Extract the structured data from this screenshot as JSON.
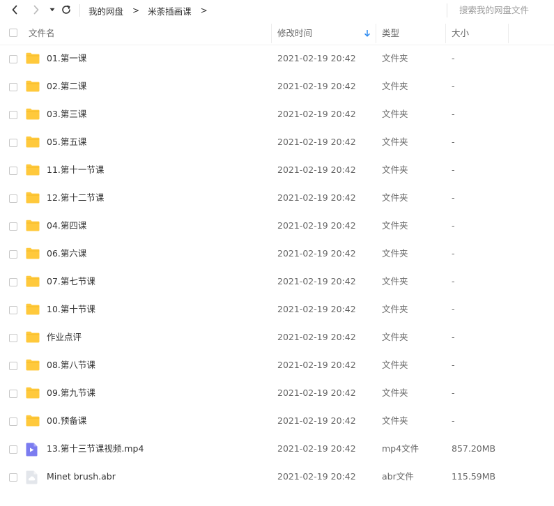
{
  "toolbar": {
    "breadcrumb": [
      {
        "label": "我的网盘"
      },
      {
        "label": "米荼插画课"
      }
    ],
    "breadcrumb_separator": ">",
    "search_placeholder": "搜索我的网盘文件"
  },
  "columns": {
    "name": "文件名",
    "modified": "修改时间",
    "type": "类型",
    "size": "大小"
  },
  "sort": {
    "column": "modified",
    "direction": "desc"
  },
  "colors": {
    "folder": "#ffc93c",
    "video": "#7b7cf0",
    "accent": "#2f8cf0"
  },
  "files": [
    {
      "icon": "folder-icon",
      "name": "01.第一课",
      "modified": "2021-02-19 20:42",
      "type": "文件夹",
      "size": "-"
    },
    {
      "icon": "folder-icon",
      "name": "02.第二课",
      "modified": "2021-02-19 20:42",
      "type": "文件夹",
      "size": "-"
    },
    {
      "icon": "folder-icon",
      "name": "03.第三课",
      "modified": "2021-02-19 20:42",
      "type": "文件夹",
      "size": "-"
    },
    {
      "icon": "folder-icon",
      "name": "05.第五课",
      "modified": "2021-02-19 20:42",
      "type": "文件夹",
      "size": "-"
    },
    {
      "icon": "folder-icon",
      "name": "11.第十一节课",
      "modified": "2021-02-19 20:42",
      "type": "文件夹",
      "size": "-"
    },
    {
      "icon": "folder-icon",
      "name": "12.第十二节课",
      "modified": "2021-02-19 20:42",
      "type": "文件夹",
      "size": "-"
    },
    {
      "icon": "folder-icon",
      "name": "04.第四课",
      "modified": "2021-02-19 20:42",
      "type": "文件夹",
      "size": "-"
    },
    {
      "icon": "folder-icon",
      "name": "06.第六课",
      "modified": "2021-02-19 20:42",
      "type": "文件夹",
      "size": "-"
    },
    {
      "icon": "folder-icon",
      "name": "07.第七节课",
      "modified": "2021-02-19 20:42",
      "type": "文件夹",
      "size": "-"
    },
    {
      "icon": "folder-icon",
      "name": "10.第十节课",
      "modified": "2021-02-19 20:42",
      "type": "文件夹",
      "size": "-"
    },
    {
      "icon": "folder-icon",
      "name": "作业点评",
      "modified": "2021-02-19 20:42",
      "type": "文件夹",
      "size": "-"
    },
    {
      "icon": "folder-icon",
      "name": "08.第八节课",
      "modified": "2021-02-19 20:42",
      "type": "文件夹",
      "size": "-"
    },
    {
      "icon": "folder-icon",
      "name": "09.第九节课",
      "modified": "2021-02-19 20:42",
      "type": "文件夹",
      "size": "-"
    },
    {
      "icon": "folder-icon",
      "name": "00.预备课",
      "modified": "2021-02-19 20:42",
      "type": "文件夹",
      "size": "-"
    },
    {
      "icon": "video-file-icon",
      "name": "13.第十三节课视频.mp4",
      "modified": "2021-02-19 20:42",
      "type": "mp4文件",
      "size": "857.20MB"
    },
    {
      "icon": "generic-file-icon",
      "name": "Minet brush.abr",
      "modified": "2021-02-19 20:42",
      "type": "abr文件",
      "size": "115.59MB"
    }
  ]
}
